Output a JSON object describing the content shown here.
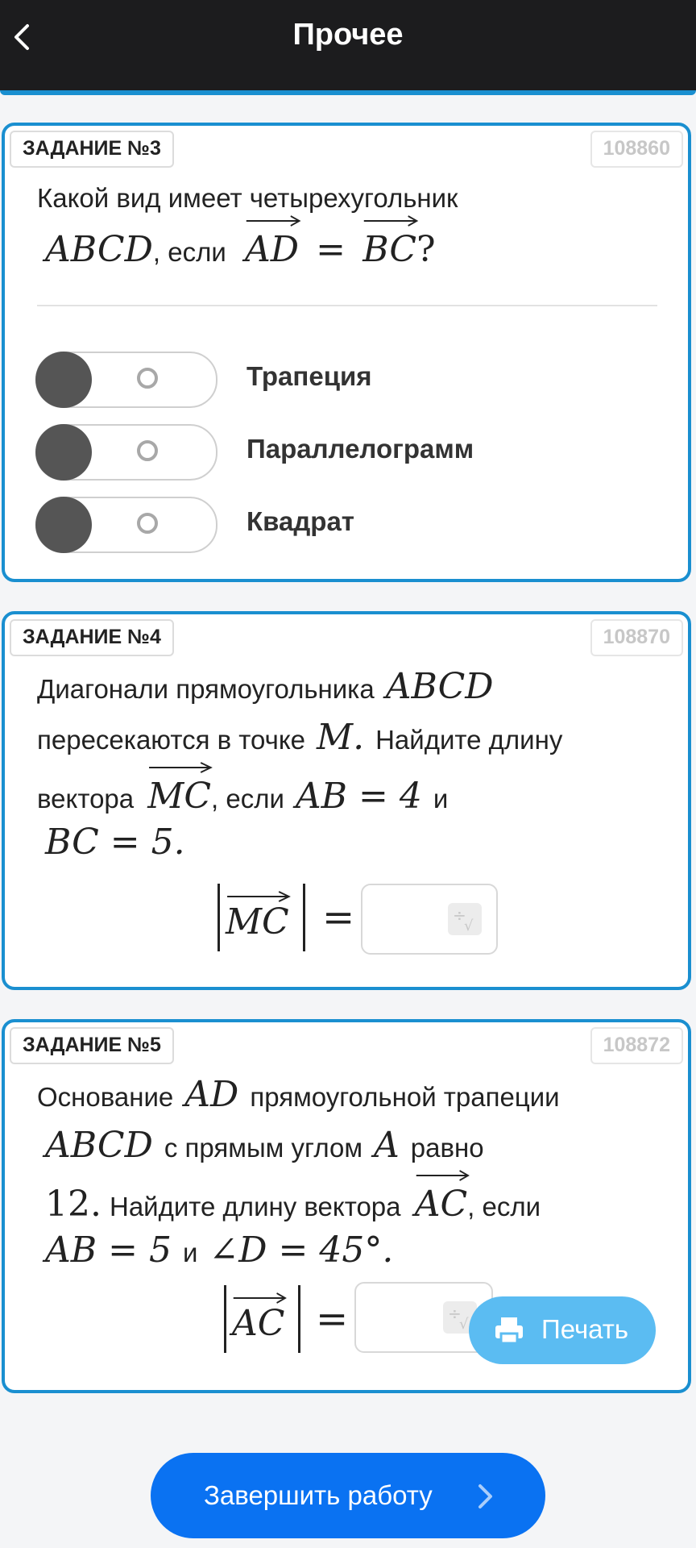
{
  "header": {
    "title": "Прочее"
  },
  "task3": {
    "tag": "ЗАДАНИЕ №3",
    "id": "108860",
    "q_line1": "Какой вид имеет четырехугольник",
    "q_abcd": "ABCD",
    "q_comma_if": ", если",
    "q_ad": "AD",
    "q_eq": "=",
    "q_bc": "BC",
    "q_end": "?",
    "options": [
      "Трапеция",
      "Параллелограмм",
      "Квадрат"
    ]
  },
  "task4": {
    "tag": "ЗАДАНИЕ №4",
    "id": "108870",
    "p1": "Диагонали прямоугольника",
    "abcd": "ABCD",
    "p2": "пересекаются в точке",
    "m": "M.",
    "p3": "Найдите длину",
    "p4": "вектора",
    "mc": "MC",
    "p5": ", если",
    "ab4": "AB = 4",
    "and": "и",
    "bc5": "BC = 5.",
    "answer_vec": "MC",
    "eq": "="
  },
  "task5": {
    "tag": "ЗАДАНИЕ №5",
    "id": "108872",
    "p1": "Основание",
    "ad": "AD",
    "p2": "прямоугольной трапеции",
    "abcd": "ABCD",
    "p3": "с прямым углом",
    "a": "A",
    "p4": "равно",
    "twelve": "12.",
    "p5": "Найдите длину вектора",
    "ac": "AC",
    "p6": ", если",
    "ab5": "AB = 5",
    "and": "и",
    "angle": "∠D = 45°.",
    "answer_vec": "AC",
    "eq": "="
  },
  "print_label": "Печать",
  "finish_label": "Завершить работу"
}
